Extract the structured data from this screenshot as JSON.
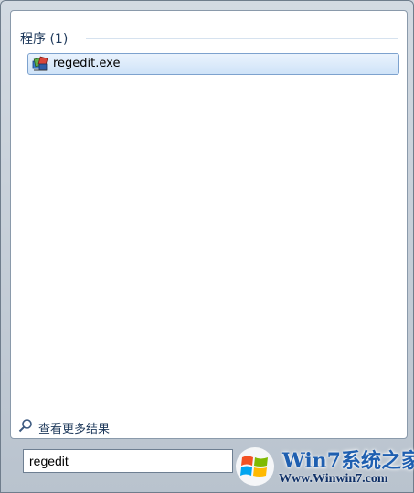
{
  "results": {
    "group_header": "程序 (1)",
    "items": [
      {
        "label": "regedit.exe",
        "icon": "registry-editor-icon"
      }
    ],
    "see_more_label": "查看更多结果",
    "see_more_icon": "magnifier-icon"
  },
  "search": {
    "value": "regedit"
  },
  "watermark": {
    "title": "Win7系统之家",
    "url": "Www.Winwin7.com"
  },
  "colors": {
    "selected_item_border": "#7da2ce",
    "header_text": "#1e395b",
    "watermark_text": "#1f5fb0"
  }
}
